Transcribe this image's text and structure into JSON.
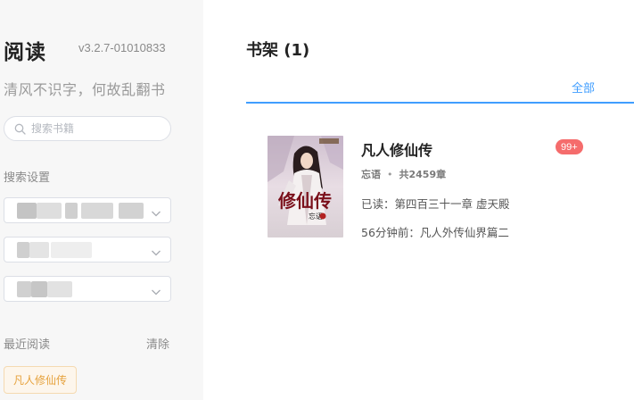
{
  "sidebar": {
    "app_title": "阅读",
    "version": "v3.2.7-01010833",
    "tagline": "清风不识字，何故乱翻书",
    "search": {
      "placeholder": "搜索书籍",
      "icon": "search-icon"
    },
    "search_settings_label": "搜索设置",
    "recent_label": "最近阅读",
    "clear_label": "清除",
    "recent_items": [
      "凡人修仙传"
    ]
  },
  "main": {
    "title": "书架 (1)",
    "tab_all": "全部",
    "books": [
      {
        "name": "凡人修仙传",
        "badge": "99+",
        "author": "忘语",
        "chapter_count": "共2459章",
        "last_read": "已读：第四百三十一章 虚天殿",
        "latest": "56分钟前：凡人外传仙界篇二"
      }
    ]
  },
  "colors": {
    "accent": "#409eff",
    "badge": "#f56c6c",
    "chip_text": "#e6a23c",
    "chip_bg": "#fdf6ec",
    "sidebar_bg": "#f7f7f7"
  }
}
